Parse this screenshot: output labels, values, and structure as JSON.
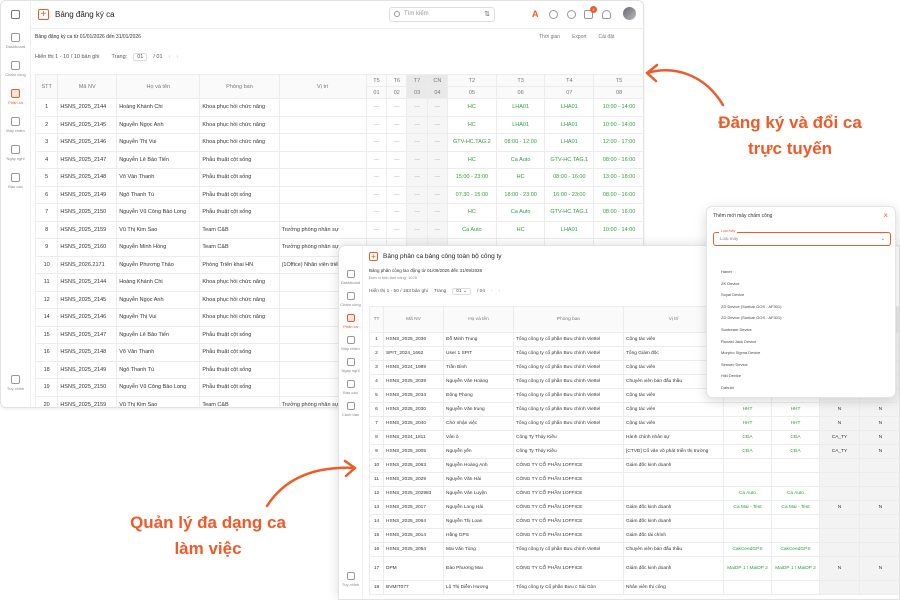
{
  "main": {
    "title": "Bảng đăng ký ca",
    "subtitle": "Bảng đăng ký ca từ 01/01/2026 đến 31/01/2026",
    "search_placeholder": "Tìm kiếm",
    "notif_count": "4",
    "actions": [
      "Thời gian",
      "Export",
      "Cài đặt"
    ],
    "pager": {
      "range": "Hiển thị 1 - 10 / 10 bản ghi",
      "page_label": "Trang:",
      "page": "01",
      "total": "/ 01"
    },
    "sidebar": [
      "Dashboard",
      "Chấm công",
      "Phân ca",
      "Máy chấm",
      "Ngày nghỉ",
      "Báo cáo",
      "Tùy chỉnh"
    ],
    "headers": [
      "STT",
      "Mã NV",
      "Họ và tên",
      "Phòng ban",
      "Vị trí"
    ],
    "day_names": [
      "T5",
      "T6",
      "T7",
      "CN",
      "T2",
      "T3",
      "T4",
      "T5"
    ],
    "day_nums": [
      "01",
      "02",
      "03",
      "04",
      "05",
      "06",
      "07",
      "08"
    ],
    "rows": [
      [
        "1",
        "HSNS_2025_2144",
        "Hoàng Khánh Chi",
        "Khoa phục hồi chức năng",
        "",
        "—",
        "—",
        "—",
        "—",
        "HC",
        "LHA01",
        "LHA01",
        "10:00 - 14:00"
      ],
      [
        "2",
        "HSNS_2025_2145",
        "Nguyễn Ngọc Anh",
        "Khoa phục hồi chức năng",
        "",
        "—",
        "—",
        "—",
        "—",
        "HC",
        "LHA01",
        "LHA01",
        "10:00 - 14:00"
      ],
      [
        "3",
        "HSNS_2025_2146",
        "Nguyễn Thị Vui",
        "Khoa phục hồi chức năng",
        "",
        "—",
        "—",
        "—",
        "—",
        "GTV-HC.TAG.2",
        "08:00 - 12:00",
        "LHA01",
        "12:00 - 17:00"
      ],
      [
        "4",
        "HSNS_2025_2147",
        "Nguyễn Lê Bảo Tiến",
        "Phẫu thuật cột sống",
        "",
        "—",
        "—",
        "—",
        "—",
        "HC",
        "Ca Auto",
        "GTV-HC.TAG.1",
        "08:00 - 16:00"
      ],
      [
        "5",
        "HSNS_2025_2148",
        "Võ Văn Thanh",
        "Phẫu thuật cột sống",
        "",
        "—",
        "—",
        "—",
        "—",
        "15:00 - 23:00",
        "HC",
        "08:00 - 16:00",
        "13:00 - 18:00"
      ],
      [
        "6",
        "HSNS_2025_2149",
        "Ngô Thanh Tú",
        "Phẫu thuật cột sống",
        "",
        "—",
        "—",
        "—",
        "—",
        "07:30 - 15:00",
        "18:00 - 23:00",
        "16:00 - 23:00",
        "08:00 - 16:00"
      ],
      [
        "7",
        "HSNS_2025_2150",
        "Nguyễn Vũ Công Bảo Long",
        "Phẫu thuật cột sống",
        "",
        "—",
        "—",
        "—",
        "—",
        "HC",
        "Ca Auto",
        "GTV-HC.TAG.1",
        "08:00 - 16:00"
      ],
      [
        "8",
        "HSNS_2025_2159",
        "Vũ Thị Kim Sao",
        "Team C&B",
        "Trưởng phòng nhân sự",
        "—",
        "—",
        "—",
        "—",
        "Ca Auto",
        "HC",
        "LHA01",
        "10:00 - 14:00"
      ],
      [
        "9",
        "HSNS_2025_2160",
        "Nguyễn Minh Hồng",
        "Team C&B",
        "Trưởng phòng nhân sự",
        "",
        "",
        "",
        "",
        "",
        "",
        "",
        ""
      ],
      [
        "10",
        "HSNS_2026.2171",
        "Nguyễn Phương Thảo",
        "Phòng Triển khai HN",
        "(1Office) Nhân viên triển",
        "",
        "",
        "",
        "",
        "",
        "",
        "",
        ""
      ],
      [
        "11",
        "HSNS_2025_2144",
        "Hoàng Khánh Chi",
        "Khoa phục hồi chức năng",
        "",
        "",
        "",
        "",
        "",
        "",
        "",
        "",
        ""
      ],
      [
        "12",
        "HSNS_2025_2145",
        "Nguyễn Ngọc Anh",
        "Khoa phục hồi chức năng",
        "",
        "",
        "",
        "",
        "",
        "",
        "",
        "",
        ""
      ],
      [
        "14",
        "HSNS_2025_2146",
        "Nguyễn Thị Vui",
        "Khoa phục hồi chức năng",
        "",
        "",
        "",
        "",
        "",
        "",
        "",
        "",
        ""
      ],
      [
        "15",
        "HSNS_2025_2147",
        "Nguyễn Lê Bảo Tiến",
        "Phẫu thuật cột sống",
        "",
        "",
        "",
        "",
        "",
        "",
        "",
        "",
        ""
      ],
      [
        "16",
        "HSNS_2025_2148",
        "Võ Văn Thanh",
        "Phẫu thuật cột sống",
        "",
        "",
        "",
        "",
        "",
        "",
        "",
        "",
        ""
      ],
      [
        "18",
        "HSNS_2025_2149",
        "Ngô Thanh Tú",
        "Phẫu thuật cột sống",
        "",
        "",
        "",
        "",
        "",
        "",
        "",
        "",
        ""
      ],
      [
        "19",
        "HSNS_2025_2150",
        "Nguyễn Vũ Công Bảo Long",
        "Phẫu thuật cột sống",
        "",
        "",
        "",
        "",
        "",
        "",
        "",
        "",
        ""
      ],
      [
        "20",
        "HSNS_2025_2159",
        "Vũ Thị Kim Sao",
        "Team C&B",
        "Trưởng phòng nhân sự",
        "",
        "",
        "",
        "",
        "",
        "",
        "",
        ""
      ]
    ]
  },
  "second": {
    "title": "Bảng phân ca bảng công toàn bộ công ty",
    "subtitle": "Bảng phân công lao động từ 01/09/2026 đến 31/09/2026",
    "subtitle2": "Đơn vị tính làm công: 1025",
    "pager": {
      "range": "Hiển thị 1 - 50 / 183 bản ghi",
      "page_label": "Trang",
      "page": "01",
      "total": "/ 04"
    },
    "sidebar": [
      "Dashboard",
      "Chấm công",
      "Phân ca",
      "Máy chấm",
      "Ngày nghỉ",
      "Báo cáo",
      "Cảnh báo",
      "Tùy chỉnh"
    ],
    "headers": [
      "TT",
      "Mã NV",
      "Họ và tên",
      "Phòng ban",
      "Vị trí"
    ],
    "rows": [
      [
        "1",
        "HSNS_2025_2036",
        "Đỗ Minh Trung",
        "Tổng công ty cổ phần Bưu chính Viettel",
        "Cộng tác viên",
        "",
        "",
        "",
        ""
      ],
      [
        "2",
        "SPIT_2024_1662",
        "User 1 SPIT",
        "Tổng công ty cổ phần Bưu chính Viettel",
        "Tổng Giám đốc",
        "",
        "",
        "",
        ""
      ],
      [
        "3",
        "HSNS_2024_1989",
        "Trần Bình",
        "Tổng công ty cổ phần Bưu chính Viettel",
        "Cộng tác viên",
        "",
        "",
        "",
        ""
      ],
      [
        "4",
        "HSNS_2025_2039",
        "Nguyễn Văn Hoàng",
        "Tổng công ty cổ phần Bưu chính Viettel",
        "Chuyên viên bán đấu thầu",
        "",
        "",
        "",
        ""
      ],
      [
        "5",
        "HSNS_2025_2034",
        "Đông Phong",
        "Tổng công ty cổ phần Bưu chính Viettel",
        "Cộng tác viên",
        "",
        "",
        "",
        ""
      ],
      [
        "6",
        "HSNS_2025_2030",
        "Nguyễn Văn trung",
        "Tổng công ty cổ phần Bưu chính Viettel",
        "Cộng tác viên",
        "HHT",
        "HHT",
        "N",
        "N"
      ],
      [
        "7",
        "HSNS_2025_2040",
        "Chờ nhận việc",
        "Tổng công ty cổ phần Bưu chính Viettel",
        "Cộng tác viên",
        "HHT",
        "HHT",
        "N",
        "N"
      ],
      [
        "8",
        "HSNS_2024_1811",
        "Vân ô",
        "Công Ty Thủy Kiều",
        "Hành chính nhân sự",
        "CĐA",
        "CĐA",
        "CA_TY",
        "N"
      ],
      [
        "9",
        "HSNS_2025_2005",
        "Nguyễn yến",
        "Công Ty Thủy Kiều",
        "[CTVĐ] Cổ văn võ phát triển thị trường",
        "CĐA",
        "CĐA",
        "CA_TY",
        "N"
      ],
      [
        "10",
        "HSNS_2025_2063",
        "Nguyễn Hoàng Anh",
        "CÔNG TY CỔ PHẦN 1OFFICE",
        "Giám đốc kinh doanh",
        "",
        "",
        "",
        ""
      ],
      [
        "11",
        "HSNS_2025_2029",
        "Nguyễn Văn Hải",
        "CÔNG TY CỔ PHẦN 1OFFICE",
        "",
        "",
        "",
        "",
        ""
      ],
      [
        "12",
        "HSNS_2025_202983",
        "Nguyễn Văn Luyện",
        "CÔNG TY CỔ PHẦN 1OFFICE",
        "",
        "Ca Auto",
        "Ca Auto",
        "",
        ""
      ],
      [
        "13",
        "HSNS_2025_2017",
        "Nguyễn Long Hải",
        "CÔNG TY CỔ PHẦN 1OFFICE",
        "Giám đốc kinh doanh",
        "Ca Mai - Test",
        "Ca Mai - Test",
        "N",
        "N"
      ],
      [
        "14",
        "HSNS_2025_2064",
        "Nguyễn Thị Loan",
        "CÔNG TY CỔ PHẦN 1OFFICE",
        "Giám đốc kinh doanh",
        "",
        "",
        "",
        ""
      ],
      [
        "15",
        "HSNS_2025_2014",
        "Hằng GPS",
        "CÔNG TY CỔ PHẦN 1OFFICE",
        "Giám đốc tài chính",
        "",
        "",
        "",
        ""
      ],
      [
        "16",
        "HSNS_2025_2054",
        "Mai Văn Tùng",
        "Tổng công ty cổ phần Bưu chính Viettel",
        "Chuyên viên bán đấu thầu",
        "CakCeedGPS",
        "CakCeedGPS",
        "",
        ""
      ],
      [
        "17",
        "DPM",
        "Đào Phương Mai",
        "CÔNG TY CỔ PHẦN 1OFFICE",
        "Giám đốc kinh doanh",
        "MaiDP 1 / MaiDP 2",
        "MaiDP 1 / MaiDP 2",
        "N",
        "N"
      ],
      [
        "18",
        "BVMIT077",
        "Lộ Thị Diễm Hương",
        "Tổng công ty Cổ phần Bưu c Sài Gòn",
        "Nhân viên thi công",
        "",
        "",
        "",
        ""
      ]
    ]
  },
  "modal": {
    "title": "Thêm mới máy chấm công",
    "select_label": "Loại máy",
    "select_value": "Loại máy",
    "options": [
      "Hanet",
      "ZK Device",
      "Soyal Device",
      "ZD Device (Sunbar GOS - AF301)",
      "ZD Device (Sunbar GOS - AF301)",
      "Suntream Device",
      "Ronald Jack Device",
      "Morpho Sigma Device",
      "Sensec Device",
      "Hiki Device",
      "Dahubi"
    ]
  },
  "annotations": {
    "top": "Đăng ký và đổi ca trực tuyến",
    "top_line1": "Đăng ký và đổi ca",
    "top_line2": "trực tuyến",
    "bottom_line1": "Quản lý đa dạng ca",
    "bottom_line2": "làm việc"
  },
  "colors": {
    "accent": "#f05a28",
    "green": "#2e9e3e"
  }
}
